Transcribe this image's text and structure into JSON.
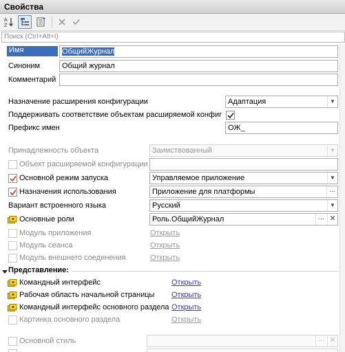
{
  "window": {
    "title": "Свойства"
  },
  "search": {
    "placeholder": "Поиск (Ctrl+Alt+I)"
  },
  "props": {
    "name": {
      "label": "Имя",
      "value": "ОбщийЖурнал"
    },
    "synonym": {
      "label": "Синоним",
      "value": "Общий журнал"
    },
    "comment": {
      "label": "Комментарий",
      "value": ""
    },
    "ext_purpose": {
      "label": "Назначение расширения конфигурации",
      "value": "Адаптация"
    },
    "keep_conformity": {
      "label": "Поддерживать соответствие объектам расширяемой конфиг",
      "checked": true
    },
    "prefix": {
      "label": "Префикс имен",
      "value": "ОЖ_"
    },
    "ownership": {
      "label": "Принадлежность объекта",
      "value": "Заимствованный"
    },
    "ext_object": {
      "label": "Объект расширяемой конфигурации",
      "value": ""
    },
    "run_mode": {
      "label": "Основной режим запуска",
      "value": "Управляемое приложение"
    },
    "usage": {
      "label": "Назначения использования",
      "value": "Приложение для платформы"
    },
    "script_variant": {
      "label": "Вариант встроенного языка",
      "value": "Русский"
    },
    "main_roles": {
      "label": "Основные роли",
      "value": "Роль.ОбщийЖурнал"
    },
    "app_module": {
      "label": "Модуль приложения",
      "link": "Открыть"
    },
    "session_module": {
      "label": "Модуль сеанса",
      "link": "Открыть"
    },
    "ext_conn_module": {
      "label": "Модуль внешнего соединения",
      "link": "Открыть"
    }
  },
  "presentation": {
    "header": "Представление:",
    "cmd_interface": {
      "label": "Командный интерфейс",
      "link": "Открыть"
    },
    "home_page": {
      "label": "Рабочая область начальной страницы",
      "link": "Открыть"
    },
    "main_section_cmd": {
      "label": "Командный интерфейс основного раздела",
      "link": "Открыть"
    },
    "main_section_picture": {
      "label": "Картинка основного раздела",
      "link": "Открыть"
    },
    "main_style": {
      "label": "Основной стиль",
      "value": ""
    }
  },
  "colors": {
    "accent": "#3d6cb8",
    "checkmark_red": "#c0392b"
  }
}
